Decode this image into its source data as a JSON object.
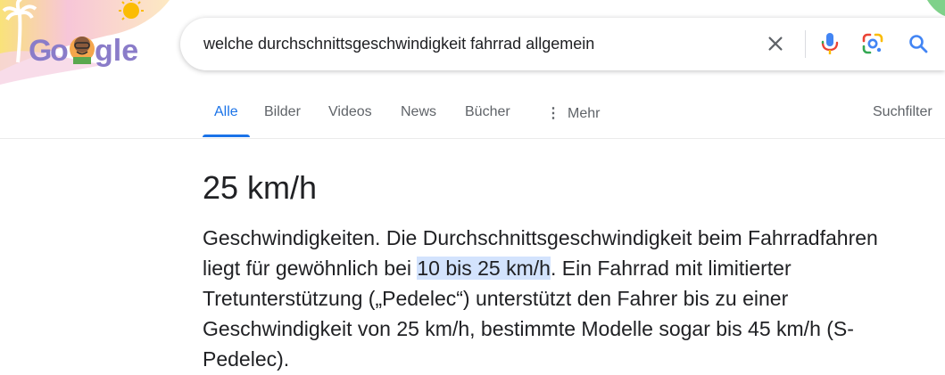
{
  "search": {
    "query": "welche durchschnittsgeschwindigkeit fahrrad allgemein"
  },
  "icons": {
    "clear": "close-icon",
    "voice": "microphone-icon",
    "lens": "google-lens-icon",
    "search": "search-icon",
    "more": "vertical-dots-icon"
  },
  "tabs": {
    "items": [
      {
        "label": "Alle",
        "active": true
      },
      {
        "label": "Bilder"
      },
      {
        "label": "Videos"
      },
      {
        "label": "News"
      },
      {
        "label": "Bücher"
      },
      {
        "label": "Mehr"
      }
    ],
    "tools_label": "Suchfilter"
  },
  "answer": {
    "title": "25 km/h",
    "snippet_before": "Geschwindigkeiten. Die Durchschnittsgeschwindigkeit beim Fahrradfahren liegt für gewöhnlich bei ",
    "snippet_highlight": "10 bis 25 km/h",
    "snippet_after": ". Ein Fahrrad mit limitierter Tretunterstützung („Pedelec“) unterstützt den Fahrer bis zu einer Geschwindigkeit von 25 km/h, bestimmte Modelle sogar bis 45 km/h (S-Pedelec)."
  },
  "colors": {
    "accent": "#1a73e8",
    "highlight": "#d3e3fd"
  }
}
